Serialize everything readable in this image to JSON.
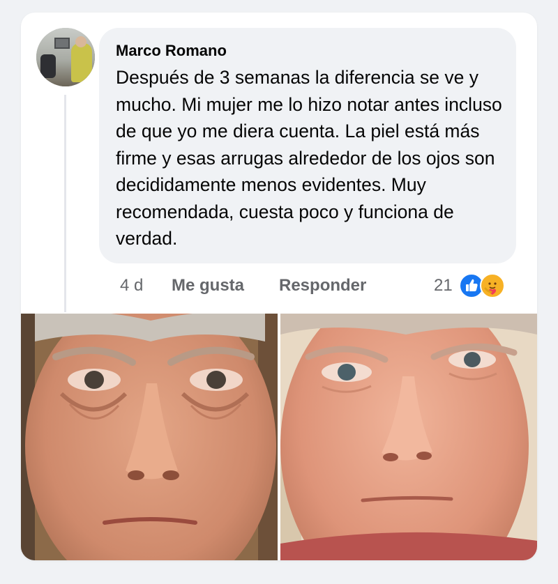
{
  "comment": {
    "author": "Marco Romano",
    "text": "Después de 3 semanas la diferencia se ve y mucho. Mi mujer me lo hizo notar antes incluso de que yo me diera cuenta. La piel está más firme y esas arrugas alrededor de los ojos son decididamente menos evidentes. Muy recomendada, cuesta poco y funciona de verdad.",
    "time": "4 d",
    "like_label": "Me gusta",
    "reply_label": "Responder",
    "reaction_count": "21",
    "reactions": [
      "like-icon",
      "care-icon"
    ]
  },
  "colors": {
    "bubble": "#f0f2f5",
    "meta_text": "#65676b",
    "like_blue": "#1877f2",
    "care_yellow": "#f7b125"
  },
  "photos": [
    "before-photo",
    "after-photo"
  ]
}
